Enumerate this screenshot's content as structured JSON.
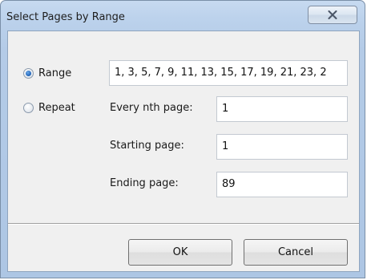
{
  "window": {
    "title": "Select Pages by Range",
    "close_icon": "close-x-icon"
  },
  "range": {
    "label": "Range",
    "selected": true,
    "value": "1, 3, 5, 7, 9, 11, 13, 15, 17, 19, 21, 23, 2"
  },
  "repeat": {
    "label": "Repeat",
    "selected": false,
    "every_nth": {
      "label": "Every nth page:",
      "value": "1"
    },
    "starting": {
      "label": "Starting page:",
      "value": "1"
    },
    "ending": {
      "label": "Ending page:",
      "value": "89"
    }
  },
  "buttons": {
    "ok": "OK",
    "cancel": "Cancel"
  },
  "colors": {
    "frame": "#b4cbe7",
    "radio_selected": "#1c5fb5"
  }
}
